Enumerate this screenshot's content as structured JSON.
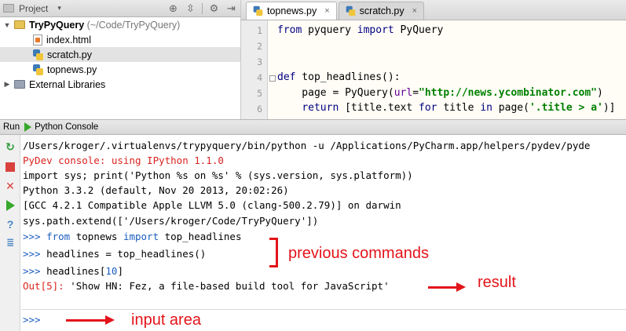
{
  "project_panel": {
    "title": "Project",
    "root": {
      "name": "TryPyQuery",
      "path": "(~/Code/TryPyQuery)"
    },
    "files": [
      {
        "name": "index.html",
        "type": "html"
      },
      {
        "name": "scratch.py",
        "type": "python",
        "selected": true
      },
      {
        "name": "topnews.py",
        "type": "python"
      }
    ],
    "external": "External Libraries"
  },
  "editor": {
    "tabs": [
      {
        "label": "topnews.py",
        "active": true
      },
      {
        "label": "scratch.py",
        "active": false
      }
    ],
    "line_numbers": [
      "1",
      "2",
      "3",
      "4",
      "5",
      "6"
    ]
  },
  "run_bar": {
    "prefix": "Run",
    "label": "Python Console"
  },
  "console": {
    "lines": [
      "/Users/kroger/.virtualenvs/trypyquery/bin/python -u /Applications/PyCharm.app/helpers/pydev/pyde",
      "PyDev console: using IPython 1.1.0",
      "import sys; print('Python %s on %s' % (sys.version, sys.platform))",
      "Python 3.3.2 (default, Nov 20 2013, 20:02:26)",
      "[GCC 4.2.1 Compatible Apple LLVM 5.0 (clang-500.2.79)] on darwin",
      "sys.path.extend(['/Users/kroger/Code/TryPyQuery'])"
    ],
    "prompt": ">>>",
    "out_label": "Out[5]:",
    "out_value": "'Show HN: Fez, a file-based build tool for JavaScript'"
  },
  "annotations": {
    "previous": "previous commands",
    "result": "result",
    "input": "input area"
  },
  "colors": {
    "annotation": "#e3141a",
    "console_error": "#d9231f",
    "prompt": "#1a5cbf"
  }
}
